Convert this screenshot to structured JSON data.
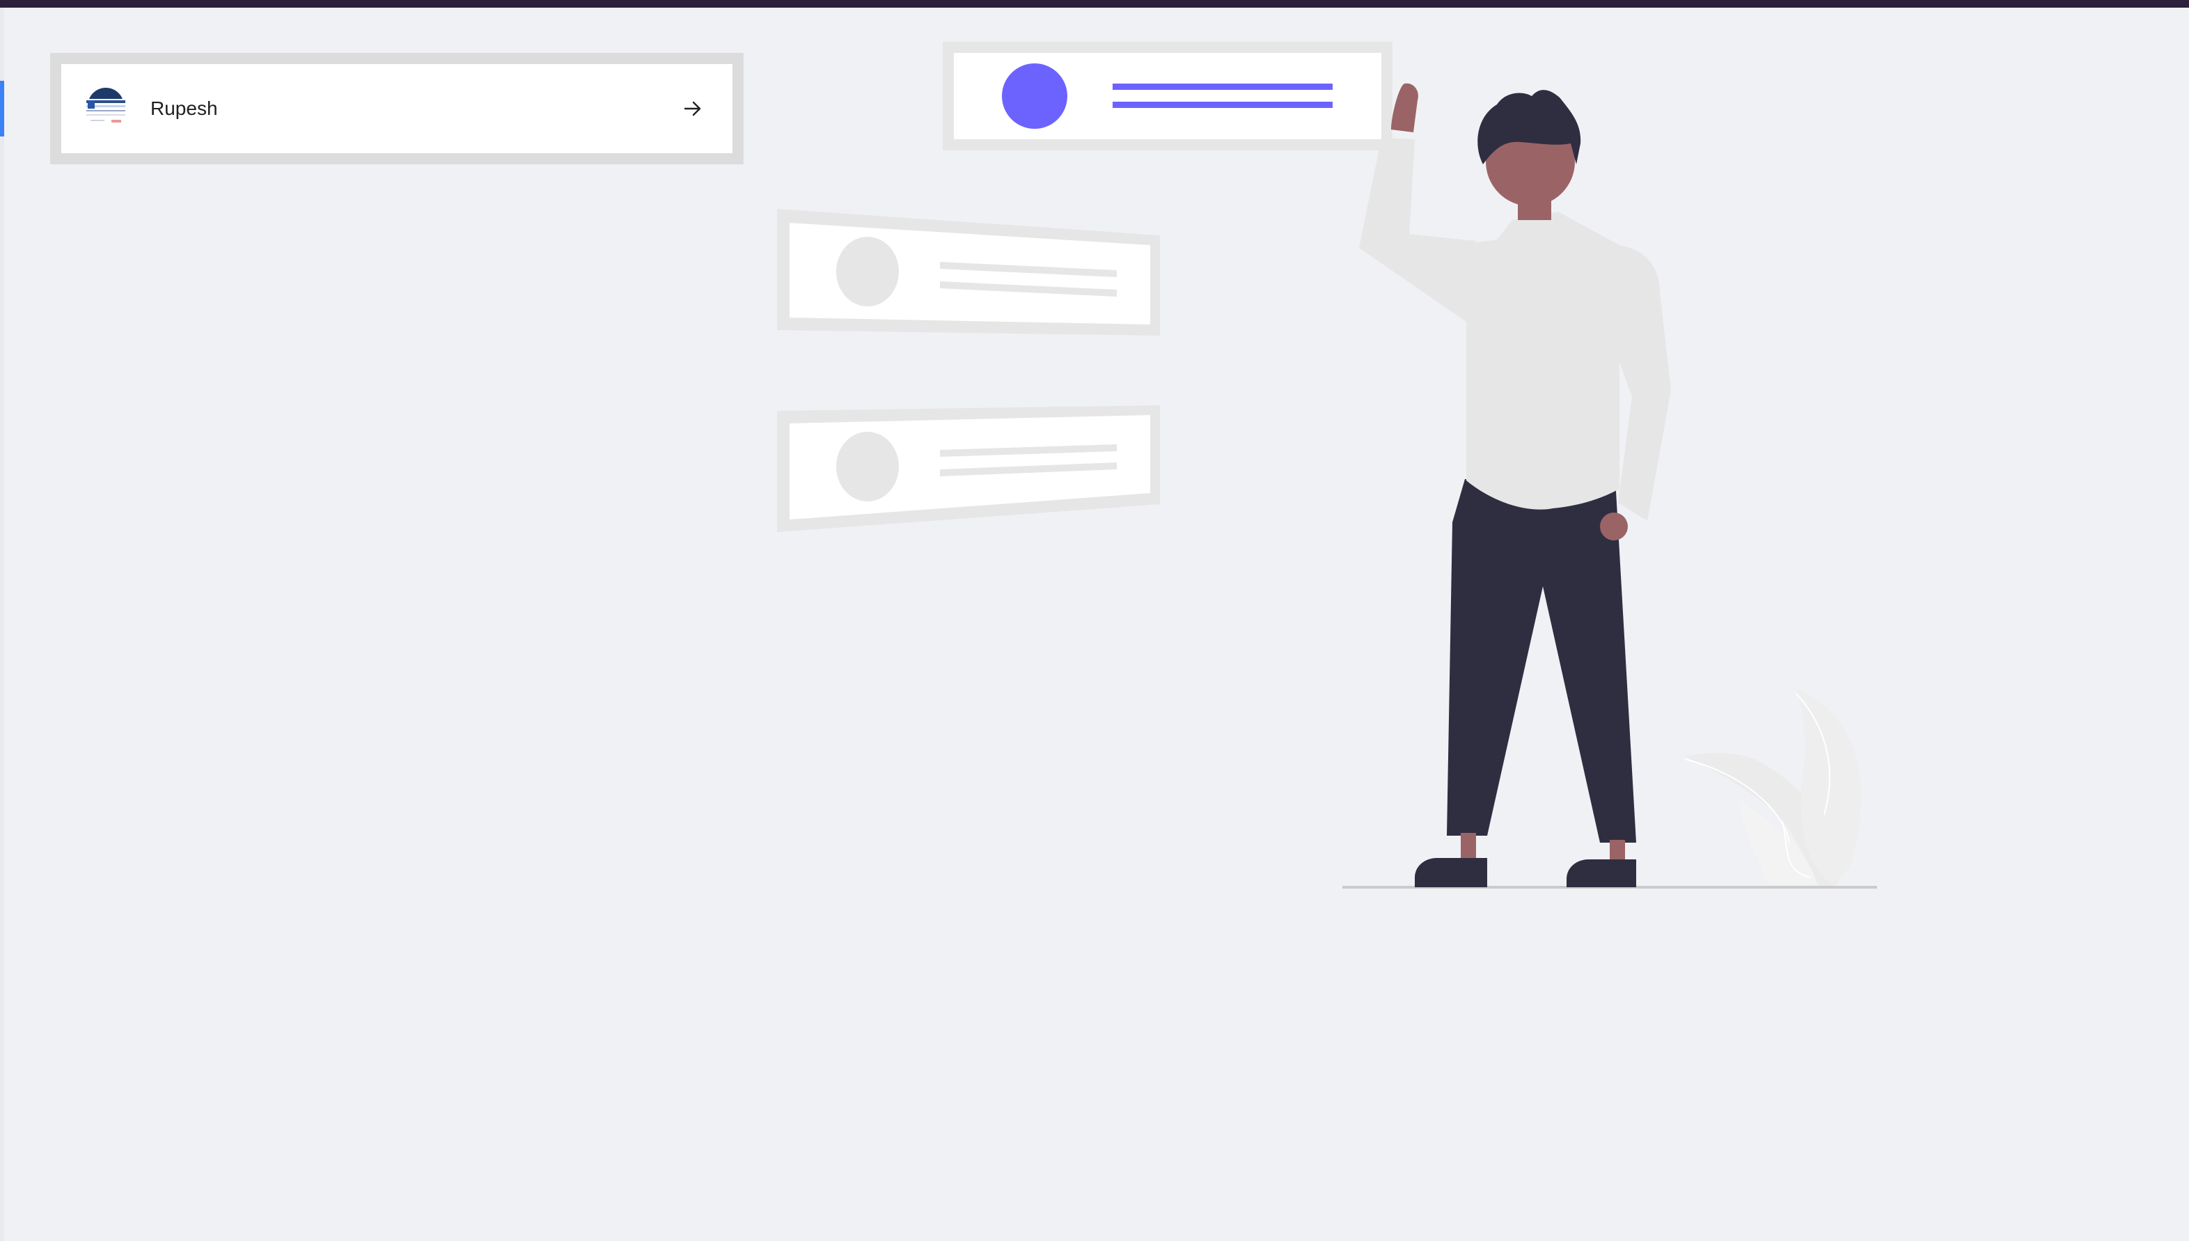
{
  "accounts": [
    {
      "name": "Rupesh",
      "action_icon": "arrow-right-icon",
      "avatar_icon": "avatar-image"
    }
  ],
  "colors": {
    "top_bar": "#2e1f3d",
    "background": "#f0f1f5",
    "accent": "#6c63ff",
    "selection_indicator": "#3b82f6"
  }
}
